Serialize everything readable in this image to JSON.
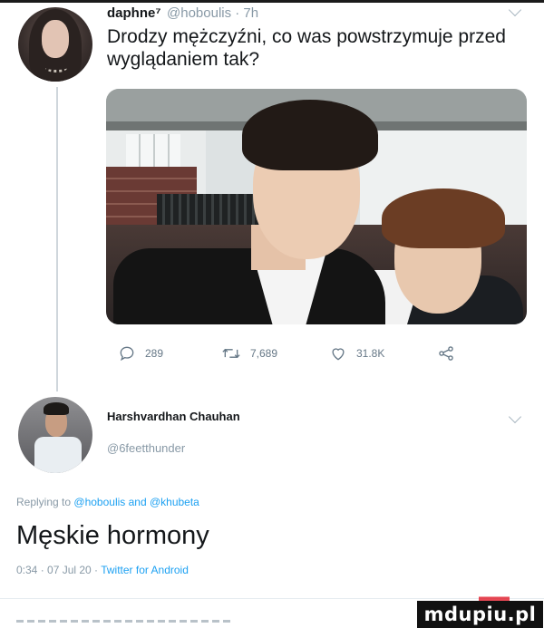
{
  "original_tweet": {
    "display_name": "daphne⁷",
    "handle_time": "@hoboulis · 7h",
    "text": "Drodzy mężczyźni, co was powstrzymuje przed wyglądaniem tak?",
    "actions": {
      "replies": "289",
      "retweets": "7,689",
      "likes": "31.8K"
    }
  },
  "reply_tweet": {
    "display_name": "Harshvardhan Chauhan",
    "handle": "@6feetthunder",
    "replying_prefix": "Replying to",
    "replying_mentions": "@hoboulis and @khubeta",
    "text": "Męskie hormony",
    "meta_time": "0:34 · 07 Jul 20 ·",
    "meta_app": "Twitter for Android"
  },
  "watermark": "mdupiu.pl",
  "colors": {
    "text": "#14171a",
    "secondary": "#8899a6",
    "link": "#1da1f2",
    "icon": "#657786"
  },
  "icons": [
    "reply-icon",
    "retweet-icon",
    "like-icon",
    "share-icon",
    "chevron-down-icon"
  ]
}
